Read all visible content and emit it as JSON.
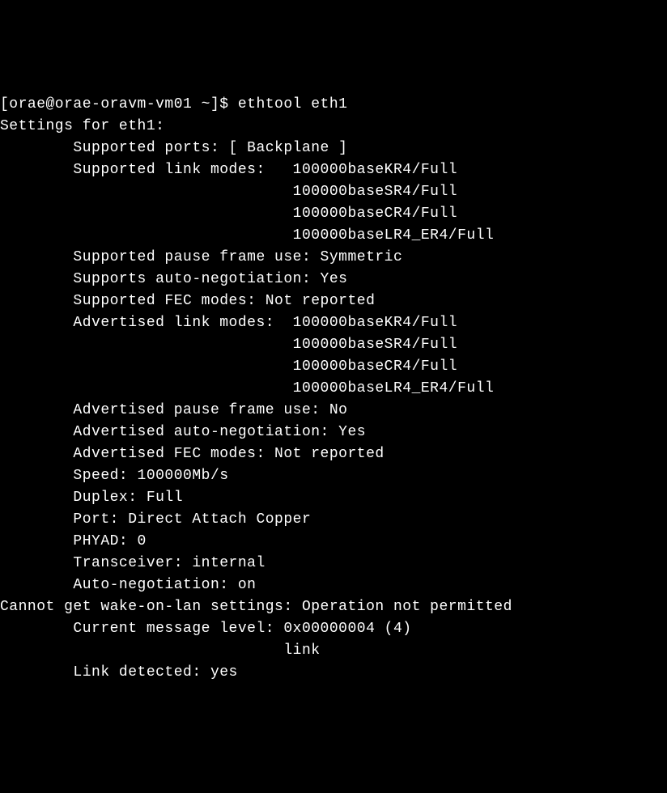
{
  "prompt_line": "[orae@orae-oravm-vm01 ~]$ ethtool eth1",
  "header_line": "Settings for eth1:",
  "supported_ports": "        Supported ports: [ Backplane ]",
  "supported_link_modes_1": "        Supported link modes:   100000baseKR4/Full",
  "supported_link_modes_2": "                                100000baseSR4/Full",
  "supported_link_modes_3": "                                100000baseCR4/Full",
  "supported_link_modes_4": "                                100000baseLR4_ER4/Full",
  "supported_pause": "        Supported pause frame use: Symmetric",
  "supports_autoneg": "        Supports auto-negotiation: Yes",
  "supported_fec": "        Supported FEC modes: Not reported",
  "advertised_link_modes_1": "        Advertised link modes:  100000baseKR4/Full",
  "advertised_link_modes_2": "                                100000baseSR4/Full",
  "advertised_link_modes_3": "                                100000baseCR4/Full",
  "advertised_link_modes_4": "                                100000baseLR4_ER4/Full",
  "advertised_pause": "        Advertised pause frame use: No",
  "advertised_autoneg": "        Advertised auto-negotiation: Yes",
  "advertised_fec": "        Advertised FEC modes: Not reported",
  "speed": "        Speed: 100000Mb/s",
  "duplex": "        Duplex: Full",
  "port": "        Port: Direct Attach Copper",
  "phyad": "        PHYAD: 0",
  "transceiver": "        Transceiver: internal",
  "autoneg": "        Auto-negotiation: on",
  "error_line": "Cannot get wake-on-lan settings: Operation not permitted",
  "msg_level": "        Current message level: 0x00000004 (4)",
  "msg_link": "                               link",
  "link_detected": "        Link detected: yes"
}
